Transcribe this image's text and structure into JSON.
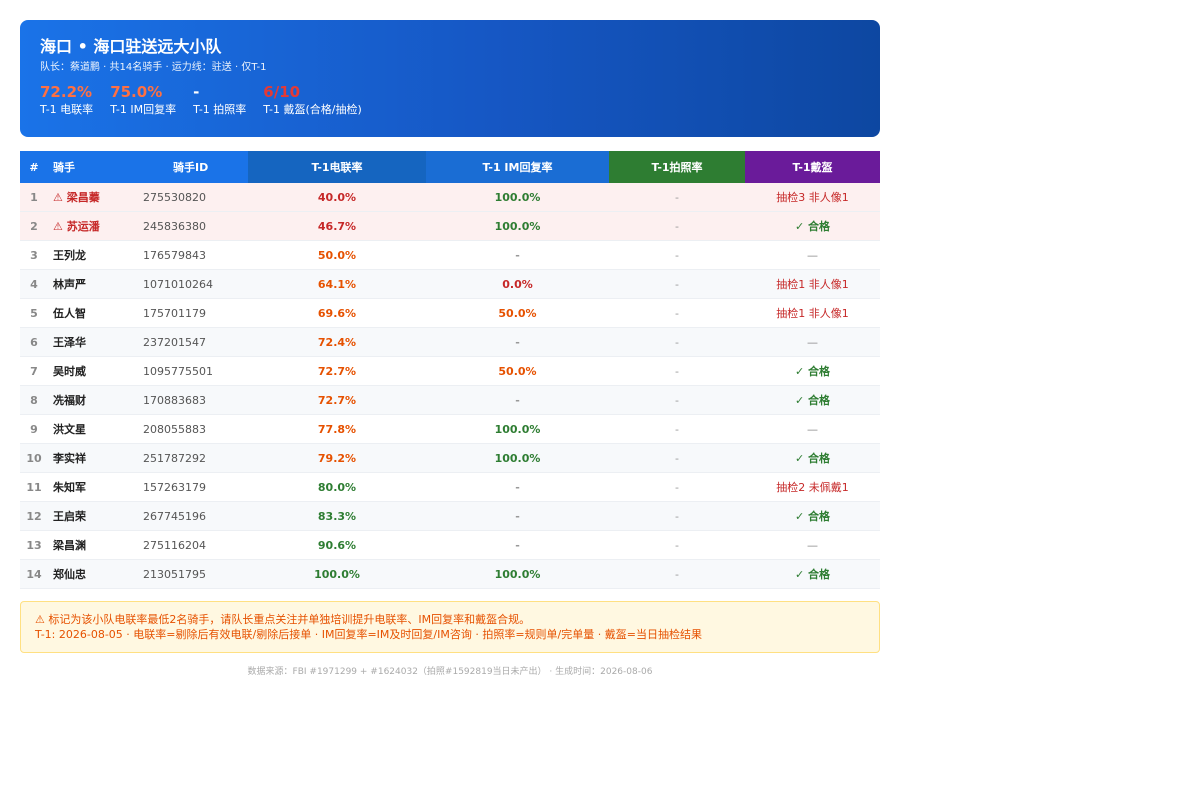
{
  "header": {
    "title": "海口 • 海口驻送远大小队",
    "subtitle": "队长：蔡道鹏 · 共14名骑手 · 运力线：驻送 · 仅T-1",
    "stats": [
      {
        "value": "72.2%",
        "label": "T-1 电联率",
        "color": "#ff7043"
      },
      {
        "value": "75.0%",
        "label": "T-1 IM回复率",
        "color": "#ff7043"
      },
      {
        "value": "-",
        "label": "T-1 拍照率",
        "color": "#ffffff"
      },
      {
        "value": "6/10",
        "label": "T-1 戴盔(合格/抽检)",
        "color": "#e53935"
      }
    ]
  },
  "table": {
    "headers": [
      "#",
      "骑手",
      "骑手ID",
      "T-1电联率",
      "T-1 IM回复率",
      "T-1拍照率",
      "T-1戴盔"
    ],
    "rows": [
      {
        "num": "1",
        "name": "⚠ 梁昌蓁",
        "id": "275530820",
        "call": "40.0%",
        "call_level": "red",
        "im": "100.0%",
        "im_level": "green",
        "photo": "-",
        "helm": "抽检3 非人像1",
        "helm_level": "fail",
        "warn": true
      },
      {
        "num": "2",
        "name": "⚠ 苏运潘",
        "id": "245836380",
        "call": "46.7%",
        "call_level": "red",
        "im": "100.0%",
        "im_level": "green",
        "photo": "-",
        "helm": "✓ 合格",
        "helm_level": "pass",
        "warn": true
      },
      {
        "num": "3",
        "name": "王列龙",
        "id": "176579843",
        "call": "50.0%",
        "call_level": "orange",
        "im": "-",
        "im_level": "grey",
        "photo": "-",
        "helm": "—",
        "helm_level": "none",
        "warn": false
      },
      {
        "num": "4",
        "name": "林声严",
        "id": "1071010264",
        "call": "64.1%",
        "call_level": "orange",
        "im": "0.0%",
        "im_level": "red",
        "photo": "-",
        "helm": "抽检1 非人像1",
        "helm_level": "fail",
        "warn": false
      },
      {
        "num": "5",
        "name": "伍人智",
        "id": "175701179",
        "call": "69.6%",
        "call_level": "orange",
        "im": "50.0%",
        "im_level": "orange",
        "photo": "-",
        "helm": "抽检1 非人像1",
        "helm_level": "fail",
        "warn": false
      },
      {
        "num": "6",
        "name": "王泽华",
        "id": "237201547",
        "call": "72.4%",
        "call_level": "orange",
        "im": "-",
        "im_level": "grey",
        "photo": "-",
        "helm": "—",
        "helm_level": "none",
        "warn": false
      },
      {
        "num": "7",
        "name": "吴时威",
        "id": "1095775501",
        "call": "72.7%",
        "call_level": "orange",
        "im": "50.0%",
        "im_level": "orange",
        "photo": "-",
        "helm": "✓ 合格",
        "helm_level": "pass",
        "warn": false
      },
      {
        "num": "8",
        "name": "冼福财",
        "id": "170883683",
        "call": "72.7%",
        "call_level": "orange",
        "im": "-",
        "im_level": "grey",
        "photo": "-",
        "helm": "✓ 合格",
        "helm_level": "pass",
        "warn": false
      },
      {
        "num": "9",
        "name": "洪文星",
        "id": "208055883",
        "call": "77.8%",
        "call_level": "orange",
        "im": "100.0%",
        "im_level": "green",
        "photo": "-",
        "helm": "—",
        "helm_level": "none",
        "warn": false
      },
      {
        "num": "10",
        "name": "李实祥",
        "id": "251787292",
        "call": "79.2%",
        "call_level": "orange",
        "im": "100.0%",
        "im_level": "green",
        "photo": "-",
        "helm": "✓ 合格",
        "helm_level": "pass",
        "warn": false
      },
      {
        "num": "11",
        "name": "朱知军",
        "id": "157263179",
        "call": "80.0%",
        "call_level": "green",
        "im": "-",
        "im_level": "grey",
        "photo": "-",
        "helm": "抽检2 未佩戴1",
        "helm_level": "fail",
        "warn": false
      },
      {
        "num": "12",
        "name": "王启荣",
        "id": "267745196",
        "call": "83.3%",
        "call_level": "green",
        "im": "-",
        "im_level": "grey",
        "photo": "-",
        "helm": "✓ 合格",
        "helm_level": "pass",
        "warn": false
      },
      {
        "num": "13",
        "name": "梁昌渊",
        "id": "275116204",
        "call": "90.6%",
        "call_level": "green",
        "im": "-",
        "im_level": "grey",
        "photo": "-",
        "helm": "—",
        "helm_level": "none",
        "warn": false
      },
      {
        "num": "14",
        "name": "郑仙忠",
        "id": "213051795",
        "call": "100.0%",
        "call_level": "green",
        "im": "100.0%",
        "im_level": "green",
        "photo": "-",
        "helm": "✓ 合格",
        "helm_level": "pass",
        "warn": false
      }
    ]
  },
  "note": {
    "line1": "⚠ 标记为该小队电联率最低2名骑手，请队长重点关注并单独培训提升电联率、IM回复率和戴盔合规。",
    "line2": "T-1: 2026-08-05 · 电联率=剔除后有效电联/剔除后接单 · IM回复率=IM及时回复/IM咨询 · 拍照率=规则单/完单量 · 戴盔=当日抽检结果"
  },
  "footer": "数据来源：FBI #1971299 + #1624032（拍照#1592819当日未产出） · 生成时间：2026-08-06"
}
